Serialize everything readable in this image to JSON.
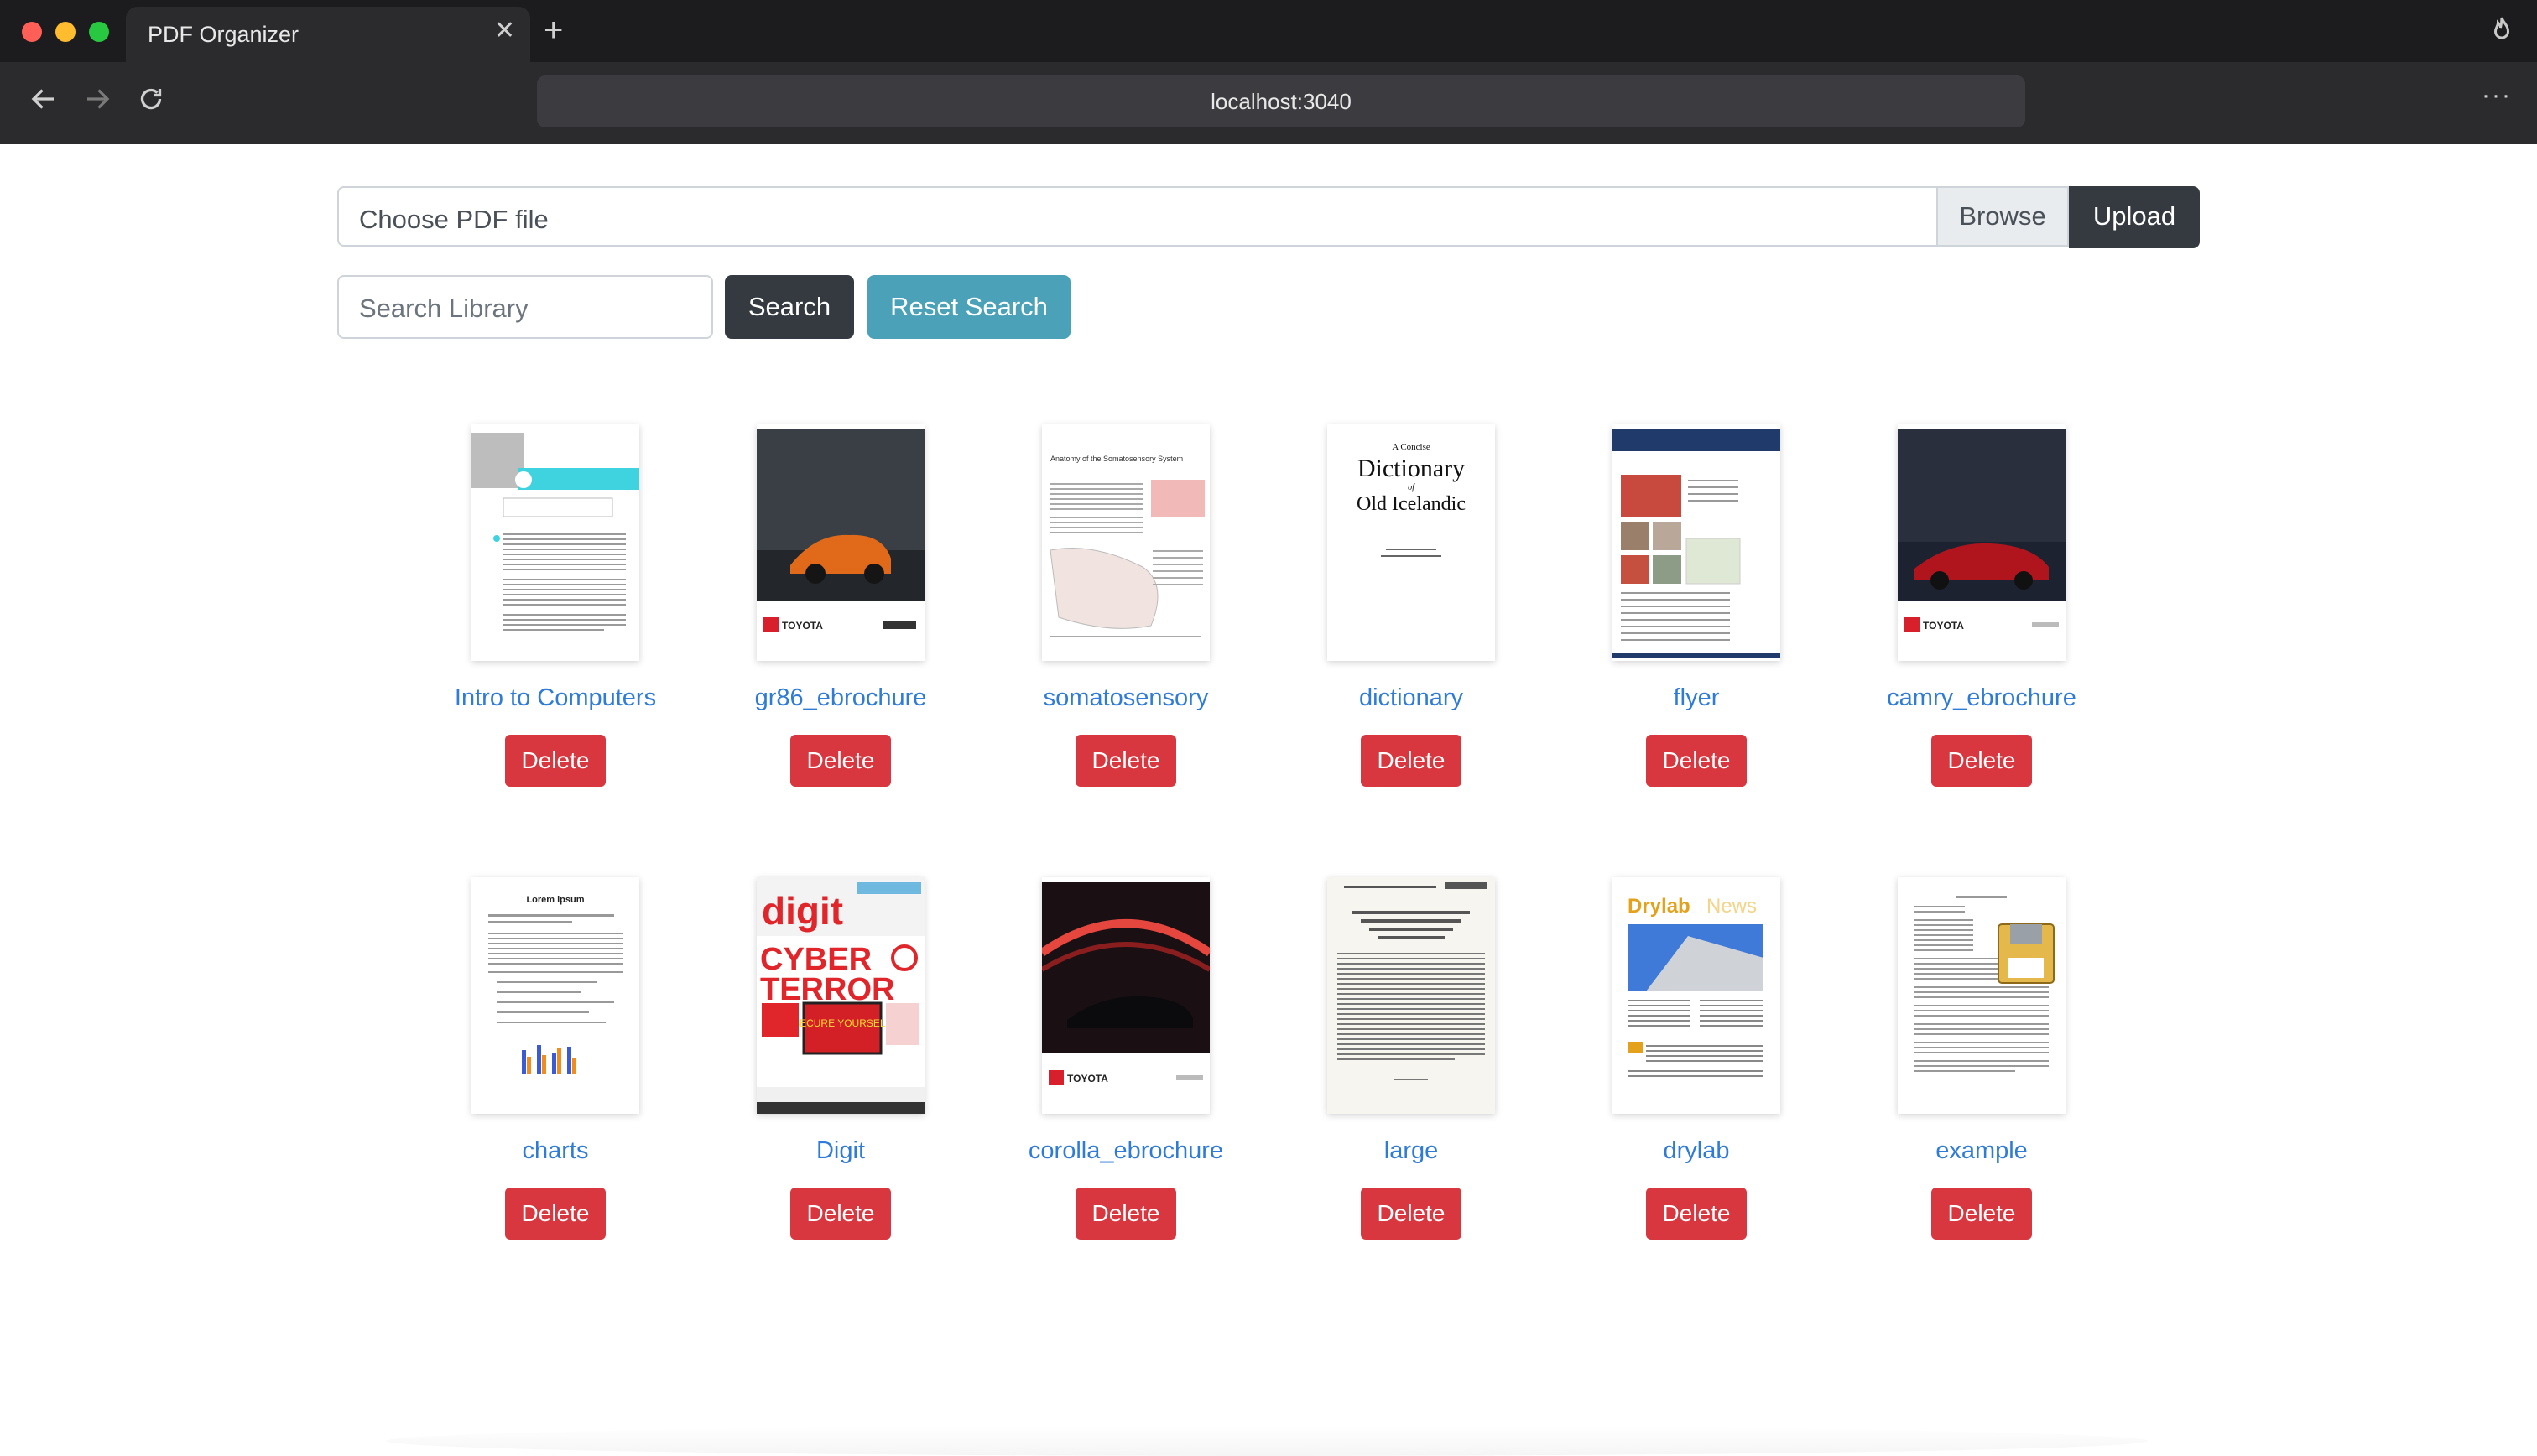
{
  "browser": {
    "tab_title": "PDF Organizer",
    "url": "localhost:3040"
  },
  "upload": {
    "file_label": "Choose PDF file",
    "browse_label": "Browse",
    "upload_label": "Upload"
  },
  "search": {
    "placeholder": "Search Library",
    "search_label": "Search",
    "reset_label": "Reset Search"
  },
  "delete_label": "Delete",
  "documents": [
    {
      "title": "Intro to Computers"
    },
    {
      "title": "gr86_ebrochure"
    },
    {
      "title": "somatosensory"
    },
    {
      "title": "dictionary"
    },
    {
      "title": "flyer"
    },
    {
      "title": "camry_ebrochure"
    },
    {
      "title": "charts"
    },
    {
      "title": "Digit"
    },
    {
      "title": "corolla_ebrochure"
    },
    {
      "title": "large"
    },
    {
      "title": "drylab"
    },
    {
      "title": "example"
    }
  ],
  "thumbnail_text": {
    "toyota": "TOYOTA",
    "somatosensory_heading": "Anatomy of the Somatosensory System",
    "dictionary_line1": "A Concise",
    "dictionary_line2": "Dictionary",
    "dictionary_line3": "of",
    "dictionary_line4": "Old Icelandic",
    "charts_heading": "Lorem ipsum",
    "digit_logo": "digit",
    "digit_headline1": "CYBER",
    "digit_headline2": "TERROR",
    "digit_badge": "SECURE YOURSELF",
    "drylab_logo": "Drylab",
    "drylab_logo2": "News"
  },
  "colors": {
    "upload_button": "#343a40",
    "search_button": "#343a40",
    "reset_button": "#4ba2b8",
    "delete_button": "#d9373f",
    "link": "#2f7bd8"
  }
}
